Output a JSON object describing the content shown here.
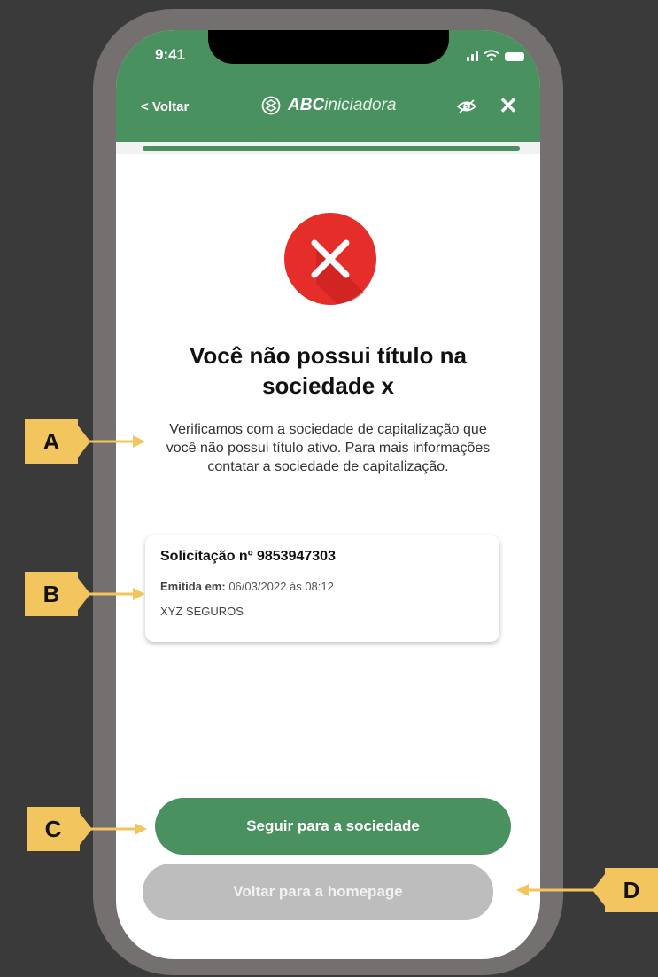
{
  "status_bar": {
    "time": "9:41"
  },
  "header": {
    "back_label": "< Voltar",
    "brand_bold": "ABC",
    "brand_light": "iniciadora",
    "close_label": "✕"
  },
  "result": {
    "title": "Você não possui título na sociedade x",
    "message": "Verificamos com a sociedade de capitalização que você não possui título ativo. Para mais informações contatar a sociedade de capitalização."
  },
  "request_card": {
    "title": "Solicitação nº 9853947303",
    "issued_label": "Emitida em:",
    "issued_value": "06/03/2022 às 08:12",
    "company": "XYZ SEGUROS"
  },
  "actions": {
    "primary_label": "Seguir para a sociedade",
    "secondary_label": "Voltar para a homepage"
  },
  "annotations": {
    "a": "A",
    "b": "B",
    "c": "C",
    "d": "D"
  },
  "colors": {
    "brand_green": "#4a9160",
    "error_red": "#e52d2a",
    "annotation_yellow": "#f3c55f",
    "disabled_gray": "#bdbdbd"
  },
  "icons": [
    "shield-logo-icon",
    "eye-off-icon",
    "close-icon",
    "error-x-icon",
    "signal-icon",
    "wifi-icon",
    "battery-icon"
  ]
}
